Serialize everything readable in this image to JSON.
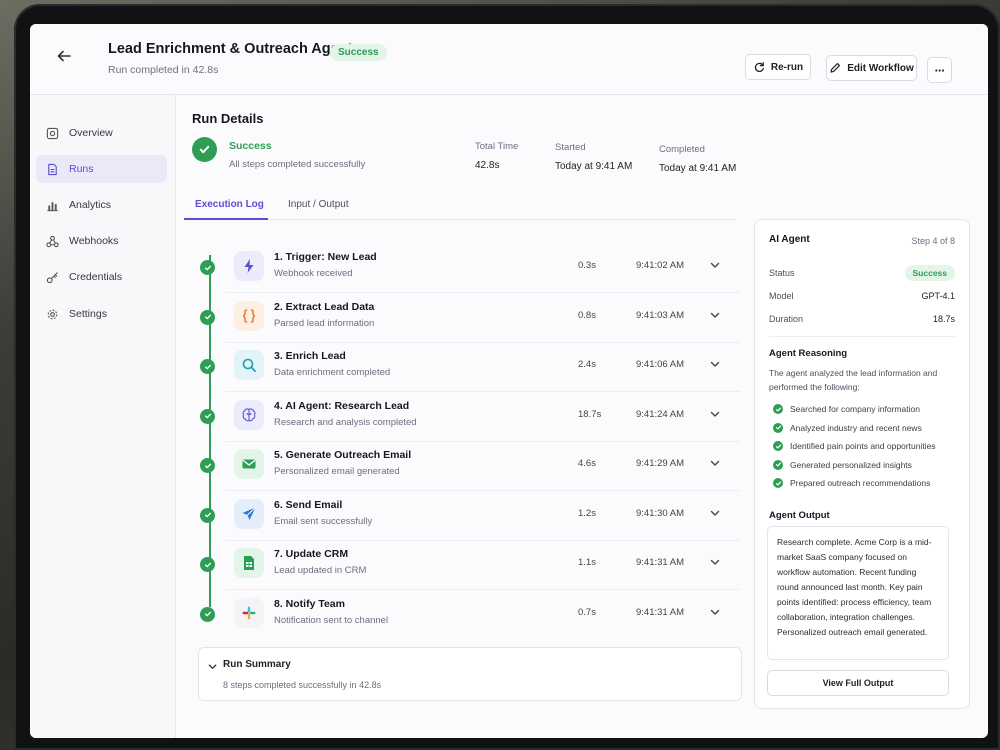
{
  "header": {
    "title": "Lead Enrichment & Outreach Agent",
    "status": "Success",
    "subtitle": "Run completed in 42.8s",
    "rerun_label": "Re-run",
    "edit_label": "Edit Workflow",
    "more_label": "···"
  },
  "sidebar": {
    "items": [
      {
        "label": "Overview",
        "icon": "overview-icon"
      },
      {
        "label": "Runs",
        "icon": "runs-icon",
        "active": true
      },
      {
        "label": "Analytics",
        "icon": "analytics-icon"
      },
      {
        "label": "Webhooks",
        "icon": "webhooks-icon"
      },
      {
        "label": "Credentials",
        "icon": "key-icon"
      },
      {
        "label": "Settings",
        "icon": "gear-icon"
      }
    ]
  },
  "run": {
    "heading": "Run Details",
    "status": "Success",
    "status_sub": "All steps completed successfully",
    "total_time_label": "Total Time",
    "total_time": "42.8s",
    "started_label": "Started",
    "started": "Today at 9:41 AM",
    "completed_label": "Completed",
    "completed": "Today at 9:41 AM"
  },
  "tabs": [
    "Execution Log",
    "Input / Output"
  ],
  "steps": [
    {
      "name": "1. Trigger: New Lead",
      "desc": "Webhook received",
      "duration": "0.3s",
      "time": "9:41:02 AM",
      "icon": "lightning-icon",
      "color": "#5a4fcf",
      "bg": "#ecebfb"
    },
    {
      "name": "2. Extract Lead Data",
      "desc": "Parsed lead information",
      "duration": "0.8s",
      "time": "9:41:03 AM",
      "icon": "braces-icon",
      "color": "#e8742c",
      "bg": "#fdefe4"
    },
    {
      "name": "3. Enrich Lead",
      "desc": "Data enrichment completed",
      "duration": "2.4s",
      "time": "9:41:06 AM",
      "icon": "search-icon",
      "color": "#1c9fb4",
      "bg": "#e2f4f7"
    },
    {
      "name": "4. AI Agent: Research Lead",
      "desc": "Research and analysis completed",
      "duration": "18.7s",
      "time": "9:41:24 AM",
      "icon": "brain-icon",
      "color": "#6b5fd8",
      "bg": "#ecebfb"
    },
    {
      "name": "5. Generate Outreach Email",
      "desc": "Personalized email generated",
      "duration": "4.6s",
      "time": "9:41:29 AM",
      "icon": "mail-icon",
      "color": "#2e9e55",
      "bg": "#e3f5e9"
    },
    {
      "name": "6. Send Email",
      "desc": "Email sent successfully",
      "duration": "1.2s",
      "time": "9:41:30 AM",
      "icon": "send-icon",
      "color": "#2a78d8",
      "bg": "#e4eefb"
    },
    {
      "name": "7. Update CRM",
      "desc": "Lead updated in CRM",
      "duration": "1.1s",
      "time": "9:41:31 AM",
      "icon": "sheet-icon",
      "color": "#2e9e55",
      "bg": "#e3f5e9"
    },
    {
      "name": "8. Notify Team",
      "desc": "Notification sent to channel",
      "duration": "0.7s",
      "time": "9:41:31 AM",
      "icon": "slack-icon",
      "color": "#e01e5a",
      "bg": "#f4f4f7"
    }
  ],
  "summary": {
    "title": "Run Summary",
    "text": "8 steps completed successfully in 42.8s"
  },
  "panel": {
    "title": "AI Agent",
    "step": "Step 4 of 8",
    "status_label": "Status",
    "status": "Success",
    "model_label": "Model",
    "model": "GPT-4.1",
    "duration_label": "Duration",
    "duration": "18.7s",
    "reasoning_title": "Agent Reasoning",
    "reasoning_intro": "The agent analyzed the lead information and performed the following:",
    "reasoning_items": [
      "Searched for company information",
      "Analyzed industry and recent news",
      "Identified pain points and opportunities",
      "Generated personalized insights",
      "Prepared outreach recommendations"
    ],
    "output_title": "Agent Output",
    "output_text": "Research complete. Acme Corp is a mid-market SaaS company focused on workflow automation. Recent funding round announced last month. Key pain points identified: process efficiency, team collaboration, integration challenges. Personalized outreach email generated.",
    "full_output_label": "View Full Output"
  },
  "colors": {
    "accent": "#5a4fcf",
    "success": "#2e9e55"
  }
}
